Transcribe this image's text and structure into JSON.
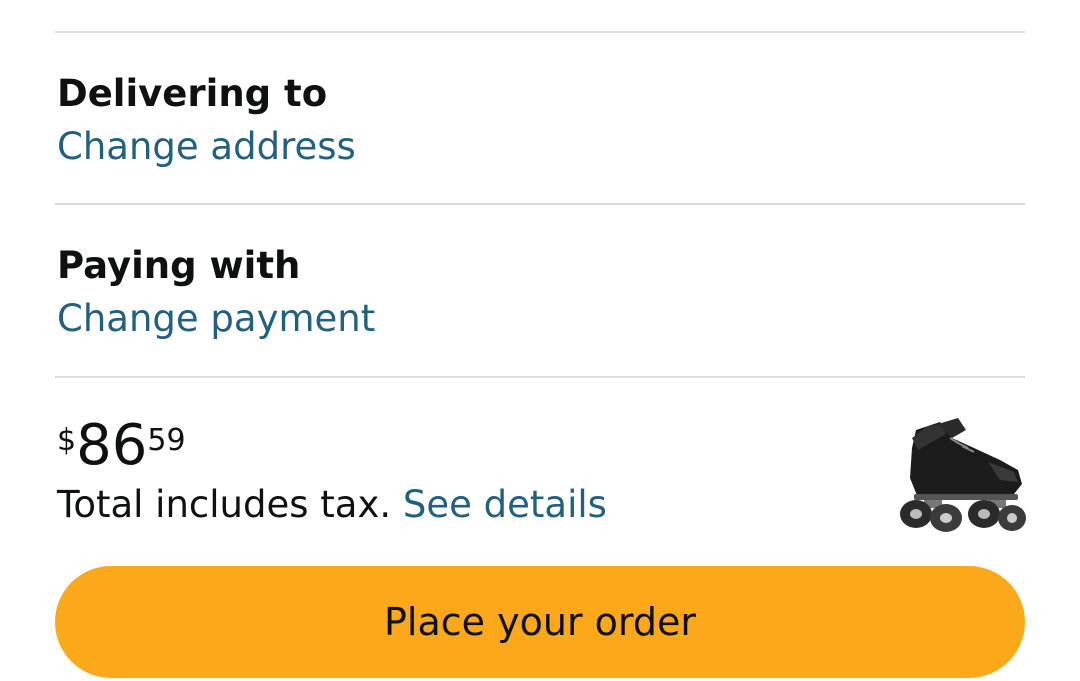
{
  "delivery": {
    "title": "Delivering to",
    "change_label": "Change address"
  },
  "payment": {
    "title": "Paying with",
    "change_label": "Change payment"
  },
  "order_total": {
    "currency_symbol": "$",
    "whole": "86",
    "fraction": "59",
    "note": "Total includes tax.",
    "details_link": "See details"
  },
  "product": {
    "icon": "roller-skate-image"
  },
  "place_order_button": {
    "label": "Place your order",
    "color": "#fba81b"
  },
  "colors": {
    "link": "#22607f",
    "text": "#0f1111",
    "divider": "#dcdcdc"
  }
}
